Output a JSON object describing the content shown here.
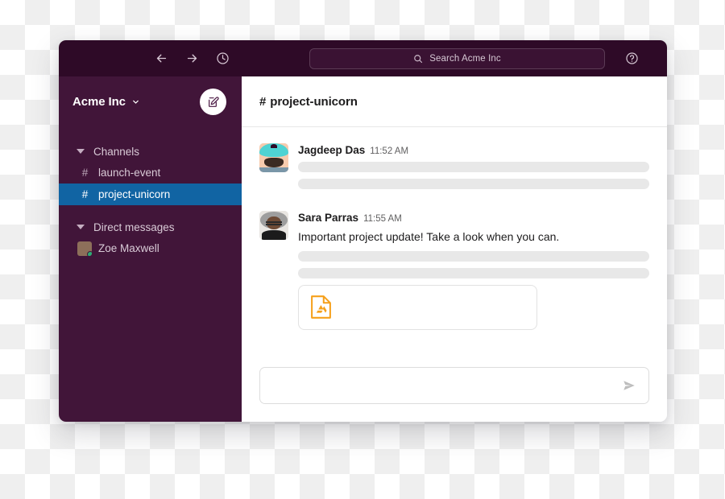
{
  "window": {
    "topbar": {
      "nav_back_icon": "arrow-left-icon",
      "nav_forward_icon": "arrow-right-icon",
      "history_icon": "clock-icon",
      "search": {
        "icon": "search-icon",
        "placeholder": "Search Acme Inc",
        "value": ""
      },
      "help_icon": "help-circle-icon",
      "user_avatar_name": "user-avatar",
      "presence": "active"
    },
    "sidebar": {
      "workspace_name": "Acme Inc",
      "workspace_chevron_icon": "chevron-down-icon",
      "compose_icon": "compose-pencil-icon",
      "sections": [
        {
          "label": "Channels",
          "caret_icon": "caret-down-icon",
          "items": [
            {
              "hash": "#",
              "name": "launch-event",
              "active": false
            },
            {
              "hash": "#",
              "name": "project-unicorn",
              "active": true
            }
          ]
        },
        {
          "label": "Direct messages",
          "caret_icon": "caret-down-icon",
          "items": [
            {
              "name": "Zoe Maxwell",
              "presence": "active"
            }
          ]
        }
      ]
    },
    "main": {
      "channel_header": {
        "hash": "#",
        "title": "project-unicorn"
      },
      "messages": [
        {
          "author": "Jagdeep Das",
          "time": "11:52 AM",
          "text": "",
          "skeleton_lines": 2,
          "attachment": null
        },
        {
          "author": "Sara Parras",
          "time": "11:55 AM",
          "text": "Important project update! Take a look when you can.",
          "skeleton_lines": 2,
          "attachment": {
            "icon": "google-drive-file-icon",
            "title": "",
            "subtitle": ""
          }
        }
      ],
      "composer": {
        "placeholder": "",
        "value": "",
        "send_icon": "send-paper-plane-icon"
      }
    }
  },
  "colors": {
    "topbar_bg": "#2E0A27",
    "sidebar_bg": "#411539",
    "active_channel_bg": "#1164A3",
    "presence_green": "#2BAC76",
    "drive_orange": "#F6A01A",
    "text_primary": "#1D1C1D",
    "text_muted": "#616061",
    "skeleton": "#E8E8E8"
  }
}
